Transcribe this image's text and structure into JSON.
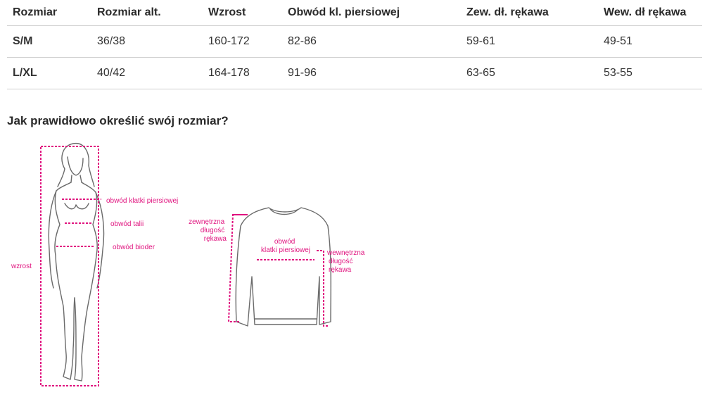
{
  "table": {
    "headers": [
      "Rozmiar",
      "Rozmiar alt.",
      "Wzrost",
      "Obwód kl. piersiowej",
      "Zew. dł. rękawa",
      "Wew. dł rękawa"
    ],
    "rows": [
      [
        "S/M",
        "36/38",
        "160-172",
        "82-86",
        "59-61",
        "49-51"
      ],
      [
        "L/XL",
        "40/42",
        "164-178",
        "91-96",
        "63-65",
        "53-55"
      ]
    ]
  },
  "guide": {
    "heading": "Jak prawidłowo określić swój rozmiar?",
    "body_labels": {
      "chest": "obwód klatki piersiowej",
      "waist": "obwód talii",
      "hips": "obwód bioder",
      "height": "wzrost"
    },
    "shirt_labels": {
      "outer_sleeve": [
        "zewnętrzna",
        "długość",
        "rękawa"
      ],
      "chest": [
        "obwód",
        "klatki piersiowej"
      ],
      "inner_sleeve": [
        "wewnętrzna",
        "długość",
        "rękawa"
      ]
    }
  },
  "colors": {
    "accent": "#e0147f",
    "outline": "#6a6a6a",
    "divider": "#cfcfcf"
  }
}
